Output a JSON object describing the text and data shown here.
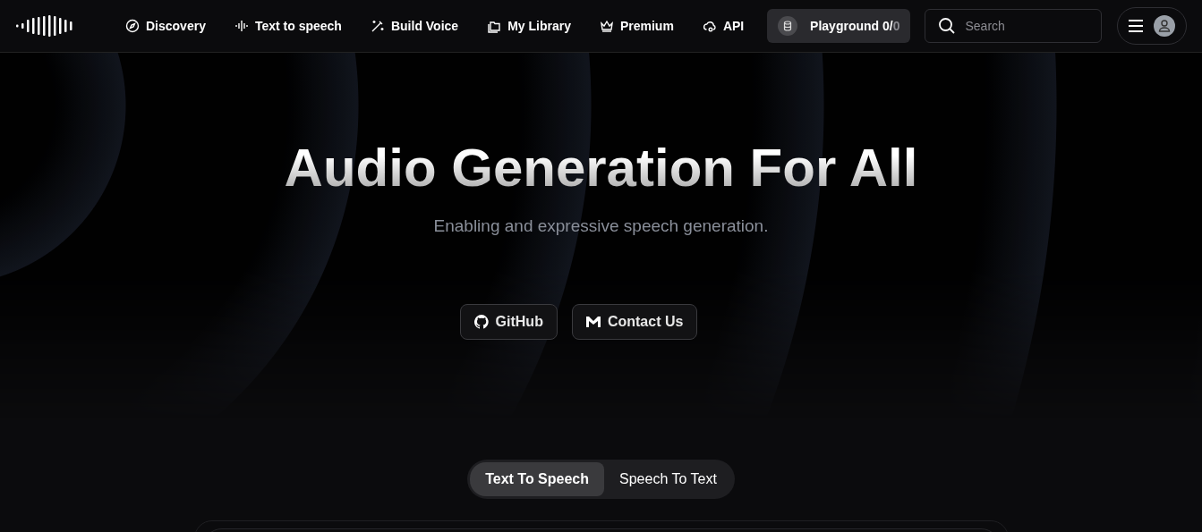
{
  "nav": {
    "items": [
      {
        "kind": "compass",
        "label": "Discovery"
      },
      {
        "kind": "wave",
        "label": "Text to speech"
      },
      {
        "kind": "wand",
        "label": "Build Voice"
      },
      {
        "kind": "folders",
        "label": "My Library"
      },
      {
        "kind": "crown",
        "label": "Premium"
      },
      {
        "kind": "cloud",
        "label": "API"
      }
    ],
    "playground": {
      "label": "Playground 0/",
      "total": "0"
    },
    "search": {
      "placeholder": "Search"
    }
  },
  "hero": {
    "title": "Audio Generation For All",
    "subtitle": "Enabling and expressive speech generation.",
    "buttons": [
      {
        "kind": "github",
        "label": "GitHub"
      },
      {
        "kind": "mail",
        "label": "Contact Us"
      }
    ]
  },
  "tabs": [
    {
      "label": "Text To Speech",
      "selected": true
    },
    {
      "label": "Speech To Text",
      "selected": false
    }
  ]
}
